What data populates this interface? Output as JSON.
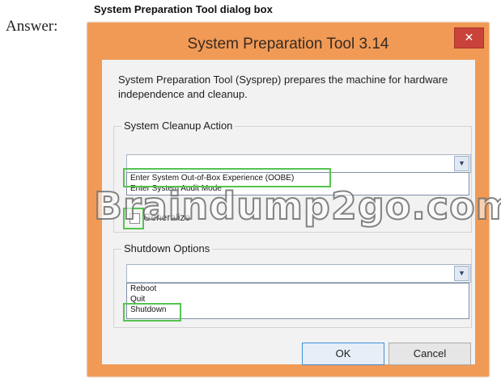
{
  "page": {
    "answer_label": "Answer:",
    "caption": "System Preparation Tool dialog box"
  },
  "dialog": {
    "title": "System Preparation Tool 3.14",
    "close_glyph": "✕",
    "description": "System Preparation Tool (Sysprep) prepares the machine for hardware independence and cleanup.",
    "cleanup": {
      "label": "System Cleanup Action",
      "options": [
        "Enter System Out-of-Box Experience (OOBE)",
        "Enter System Audit Mode"
      ],
      "generalize_label": "Generalize",
      "generalize_checked": false
    },
    "shutdown": {
      "label": "Shutdown Options",
      "options": [
        "Reboot",
        "Quit",
        "Shutdown"
      ]
    },
    "buttons": {
      "ok": "OK",
      "cancel": "Cancel"
    }
  },
  "watermark": "Braindump2go.com",
  "colors": {
    "frame": "#f09a56",
    "close": "#c9433a",
    "highlight": "#55c44f"
  },
  "icons": {
    "dropdown_arrow": "chevron-down-icon",
    "close": "close-icon"
  }
}
